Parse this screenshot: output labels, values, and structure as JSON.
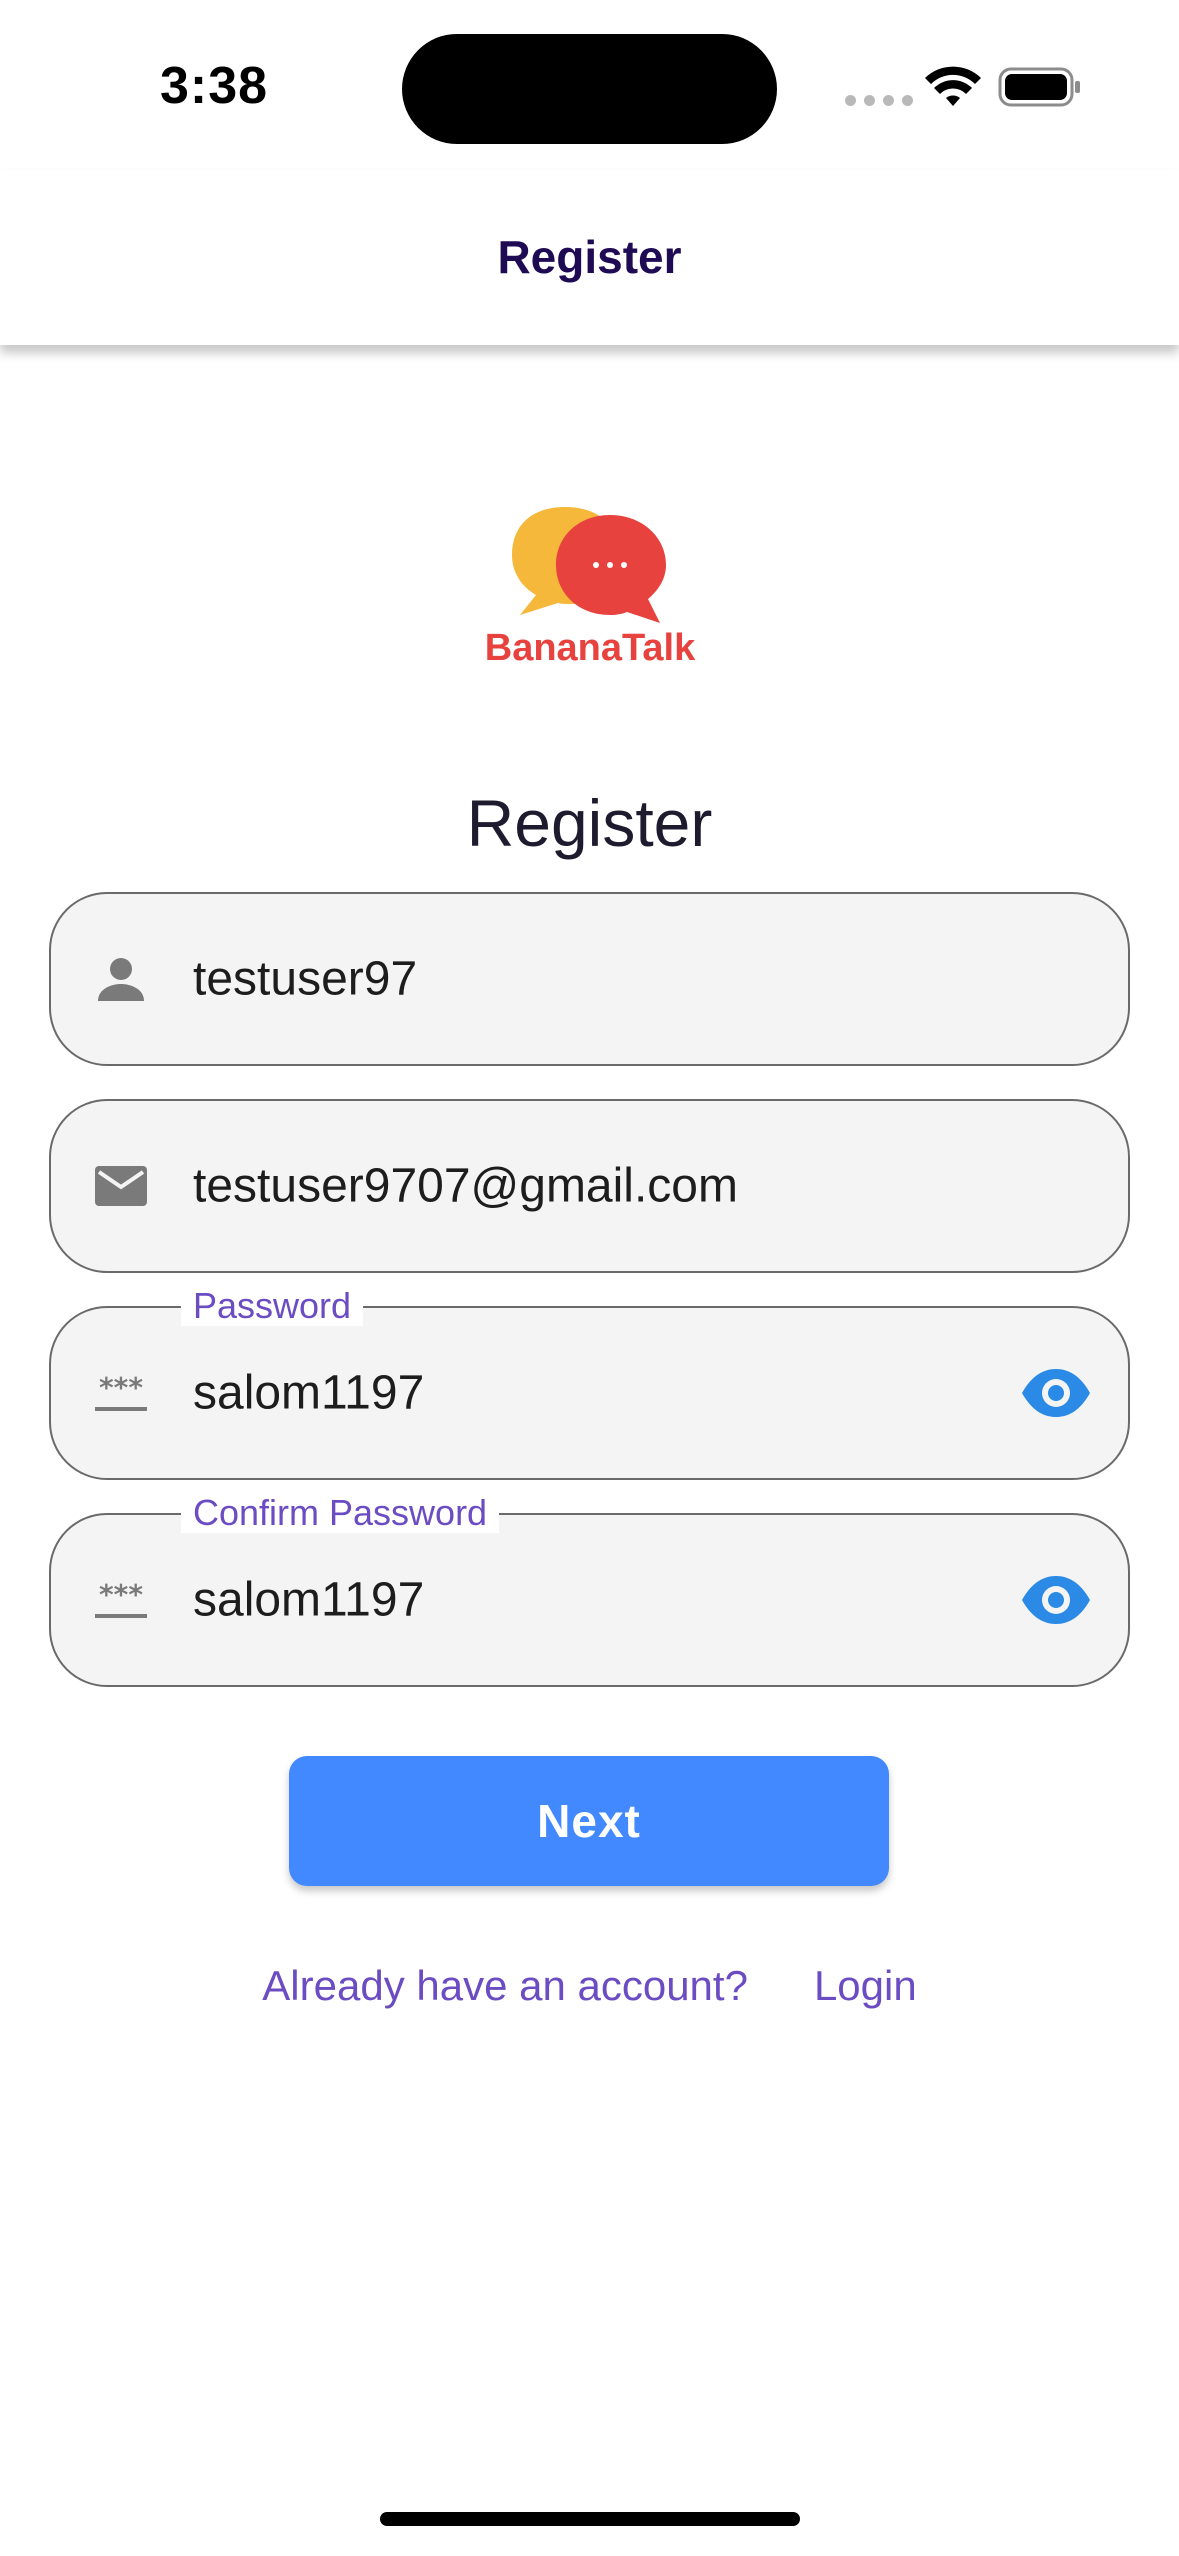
{
  "status_bar": {
    "time": "3:38"
  },
  "app_bar": {
    "title": "Register"
  },
  "logo": {
    "text": "BananaTalk",
    "colors": {
      "yellow_bubble": "#f5b83a",
      "red_bubble": "#e8423f"
    }
  },
  "form": {
    "heading": "Register",
    "username": {
      "value": "testuser97",
      "icon": "person-icon"
    },
    "email": {
      "value": "testuser9707@gmail.com",
      "icon": "mail-icon"
    },
    "password": {
      "label": "Password",
      "value": "salom1197",
      "icon": "password-icon",
      "toggle_icon": "eye-icon"
    },
    "confirm_password": {
      "label": "Confirm Password",
      "value": "salom1197",
      "icon": "password-icon",
      "toggle_icon": "eye-icon"
    }
  },
  "actions": {
    "next_label": "Next",
    "account_prompt": "Already have an account?",
    "login_label": "Login"
  },
  "colors": {
    "accent": "#4289ff",
    "link": "#6b4cc2",
    "title": "#1f0a54",
    "eye": "#2a8ae6"
  }
}
